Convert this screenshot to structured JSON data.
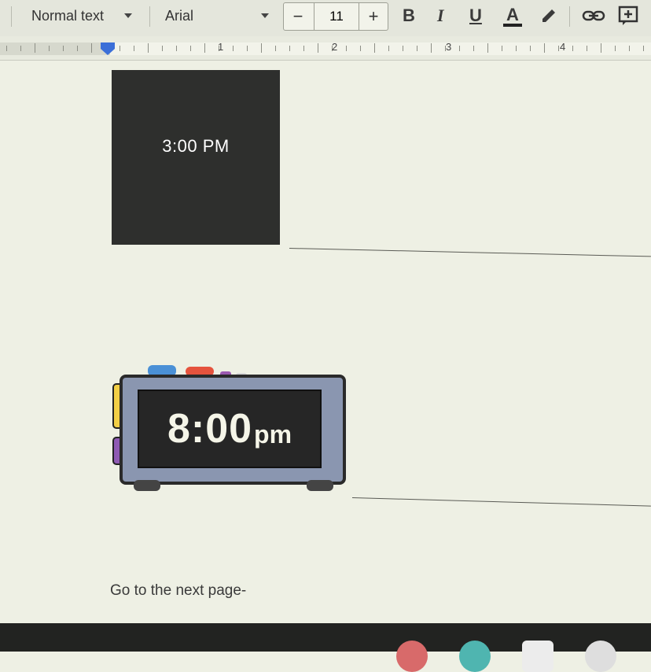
{
  "toolbar": {
    "style_label": "Normal text",
    "font_label": "Arial",
    "font_size_value": "11",
    "decrease_label": "−",
    "increase_label": "+",
    "bold_label": "B",
    "italic_label": "I",
    "underline_label": "U",
    "text_color_label": "A",
    "icons": [
      "chevron-down-icon",
      "highlighter-icon",
      "link-icon",
      "add-comment-icon"
    ]
  },
  "ruler": {
    "numbers": [
      "1",
      "2",
      "3",
      "4"
    ]
  },
  "document": {
    "dark_card_text": "3:00 PM",
    "clock_time": "8:00",
    "clock_suffix": "pm",
    "footer_text": "Go to the next page-"
  },
  "colors": {
    "indent_marker": "#3b6fd8",
    "card_bg": "#2e2f2d",
    "clock_frame": "#8a96b0"
  }
}
